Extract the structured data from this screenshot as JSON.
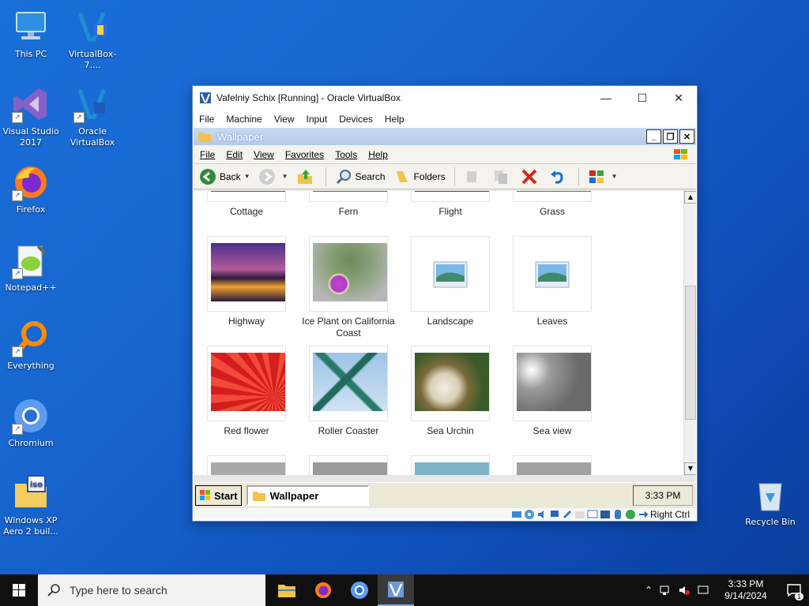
{
  "desktop": {
    "icons": [
      {
        "label": "This PC"
      },
      {
        "label": "VirtualBox-7...."
      },
      {
        "label": "Visual Studio 2017"
      },
      {
        "label": "Oracle VirtualBox"
      },
      {
        "label": "Firefox"
      },
      {
        "label": "Notepad++"
      },
      {
        "label": "Everything"
      },
      {
        "label": "Chromium"
      },
      {
        "label": "Windows XP Aero 2 buil..."
      },
      {
        "label": "Recycle Bin"
      }
    ]
  },
  "vbox": {
    "title": "Vafelniy  Schix [Running] - Oracle VirtualBox",
    "menu": [
      "File",
      "Machine",
      "View",
      "Input",
      "Devices",
      "Help"
    ],
    "status_right": "Right Ctrl"
  },
  "explorer": {
    "title": "Wallpaper",
    "menu": [
      "File",
      "Edit",
      "View",
      "Favorites",
      "Tools",
      "Help"
    ],
    "toolbar": {
      "back": "Back",
      "search": "Search",
      "folders": "Folders"
    },
    "items": [
      {
        "label": "Cottage",
        "icon": "partial-image"
      },
      {
        "label": "Fern",
        "icon": "partial-image"
      },
      {
        "label": "Flight",
        "icon": "partial-image"
      },
      {
        "label": "Grass",
        "icon": "partial-image"
      },
      {
        "label": "Highway",
        "icon": "photo"
      },
      {
        "label": "Ice Plant on California Coast",
        "icon": "photo"
      },
      {
        "label": "Landscape",
        "icon": "image-file-icon"
      },
      {
        "label": "Leaves",
        "icon": "image-file-icon"
      },
      {
        "label": "Red flower",
        "icon": "photo"
      },
      {
        "label": "Roller Coaster",
        "icon": "photo"
      },
      {
        "label": "Sea Urchin",
        "icon": "photo"
      },
      {
        "label": "Sea view",
        "icon": "photo"
      }
    ]
  },
  "xp_taskbar": {
    "start": "Start",
    "task": "Wallpaper",
    "clock": "3:33 PM"
  },
  "taskbar": {
    "search_placeholder": "Type here to search",
    "time": "3:33 PM",
    "date": "9/14/2024",
    "notifications": "1"
  }
}
